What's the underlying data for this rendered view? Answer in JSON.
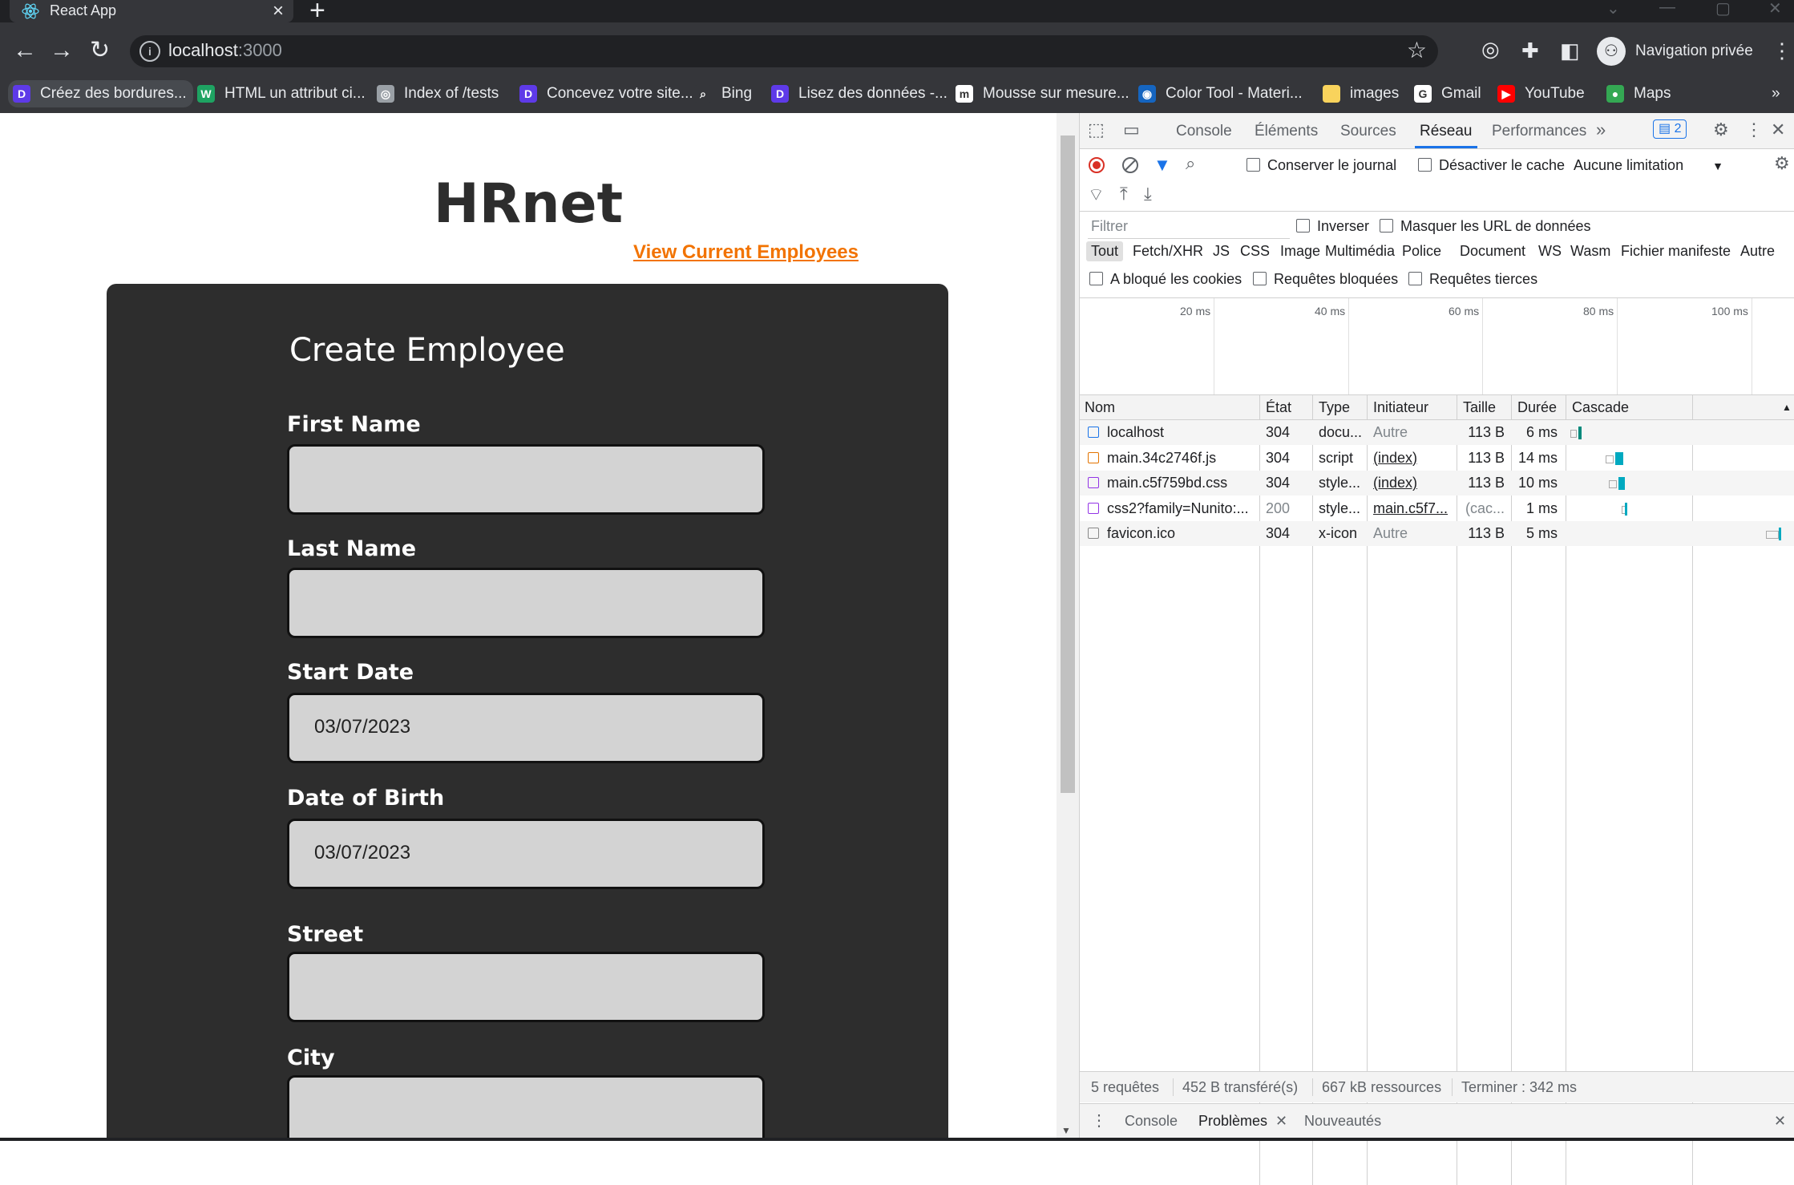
{
  "browser": {
    "tab_title": "React App",
    "url_host": "localhost",
    "url_port": ":3000",
    "profile_label": "Navigation privée",
    "bookmarks": [
      {
        "label": "Créez des bordures...",
        "color": "#5e3ae8",
        "glyph": "D"
      },
      {
        "label": "HTML un attribut ci...",
        "color": "#1ea362",
        "glyph": "W"
      },
      {
        "label": "Index of /tests",
        "color": "#9aa0a6",
        "glyph": "◎"
      },
      {
        "label": "Concevez votre site...",
        "color": "#5e3ae8",
        "glyph": "D"
      },
      {
        "label": "Bing",
        "color": "#35363a",
        "glyph": "⌕"
      },
      {
        "label": "Lisez des données -...",
        "color": "#5e3ae8",
        "glyph": "D"
      },
      {
        "label": "Mousse sur mesure...",
        "color": "#ffffff",
        "glyph": "m"
      },
      {
        "label": "Color Tool - Materi...",
        "color": "#1565c0",
        "glyph": "◉"
      },
      {
        "label": "images",
        "color": "#f9d35c",
        "glyph": ""
      },
      {
        "label": "Gmail",
        "color": "#ffffff",
        "glyph": "G"
      },
      {
        "label": "YouTube",
        "color": "#ff0000",
        "glyph": "▶"
      },
      {
        "label": "Maps",
        "color": "#34a853",
        "glyph": "●"
      }
    ]
  },
  "page": {
    "app_title": "HRnet",
    "view_link": "View Current Employees",
    "form_title": "Create Employee",
    "fields": [
      {
        "label": "First Name",
        "value": ""
      },
      {
        "label": "Last Name",
        "value": ""
      },
      {
        "label": "Start Date",
        "value": "03/07/2023"
      },
      {
        "label": "Date of Birth",
        "value": "03/07/2023"
      },
      {
        "label": "Street",
        "value": ""
      },
      {
        "label": "City",
        "value": ""
      }
    ]
  },
  "devtools": {
    "tabs": [
      "Console",
      "Éléments",
      "Sources",
      "Réseau",
      "Performances"
    ],
    "active_tab": "Réseau",
    "issues_count": "2",
    "options": {
      "preserve_log": "Conserver le journal",
      "disable_cache": "Désactiver le cache",
      "throttling": "Aucune limitation"
    },
    "filter_placeholder": "Filtrer",
    "invert": "Inverser",
    "hide_data_urls": "Masquer les URL de données",
    "type_filters": [
      "Tout",
      "Fetch/XHR",
      "JS",
      "CSS",
      "Image",
      "Multimédia",
      "Police",
      "Document",
      "WS",
      "Wasm",
      "Fichier manifeste",
      "Autre"
    ],
    "checks_row": [
      "A bloqué les cookies",
      "Requêtes bloquées",
      "Requêtes tierces"
    ],
    "timeline_ticks": [
      "20 ms",
      "40 ms",
      "60 ms",
      "80 ms",
      "100 ms"
    ],
    "columns": [
      "Nom",
      "État",
      "Type",
      "Initiateur",
      "Taille",
      "Durée",
      "Cascade"
    ],
    "requests": [
      {
        "name": "localhost",
        "status": "304",
        "type": "docu...",
        "initiator": "Autre",
        "size": "113 B",
        "time": "6 ms",
        "icon": "doc"
      },
      {
        "name": "main.34c2746f.js",
        "status": "304",
        "type": "script",
        "initiator": "(index)",
        "size": "113 B",
        "time": "14 ms",
        "icon": "script"
      },
      {
        "name": "main.c5f759bd.css",
        "status": "304",
        "type": "style...",
        "initiator": "(index)",
        "size": "113 B",
        "time": "10 ms",
        "icon": "style"
      },
      {
        "name": "css2?family=Nunito:...",
        "status": "200",
        "type": "style...",
        "initiator": "main.c5f7...",
        "size": "(cac...",
        "time": "1 ms",
        "icon": "style"
      },
      {
        "name": "favicon.ico",
        "status": "304",
        "type": "x-icon",
        "initiator": "Autre",
        "size": "113 B",
        "time": "5 ms",
        "icon": "other"
      }
    ],
    "summary": {
      "requests": "5 requêtes",
      "transferred": "452 B transféré(s)",
      "resources": "667 kB ressources",
      "finish": "Terminer : 342 ms"
    },
    "drawer_tabs": [
      "Console",
      "Problèmes",
      "Nouveautés"
    ]
  }
}
